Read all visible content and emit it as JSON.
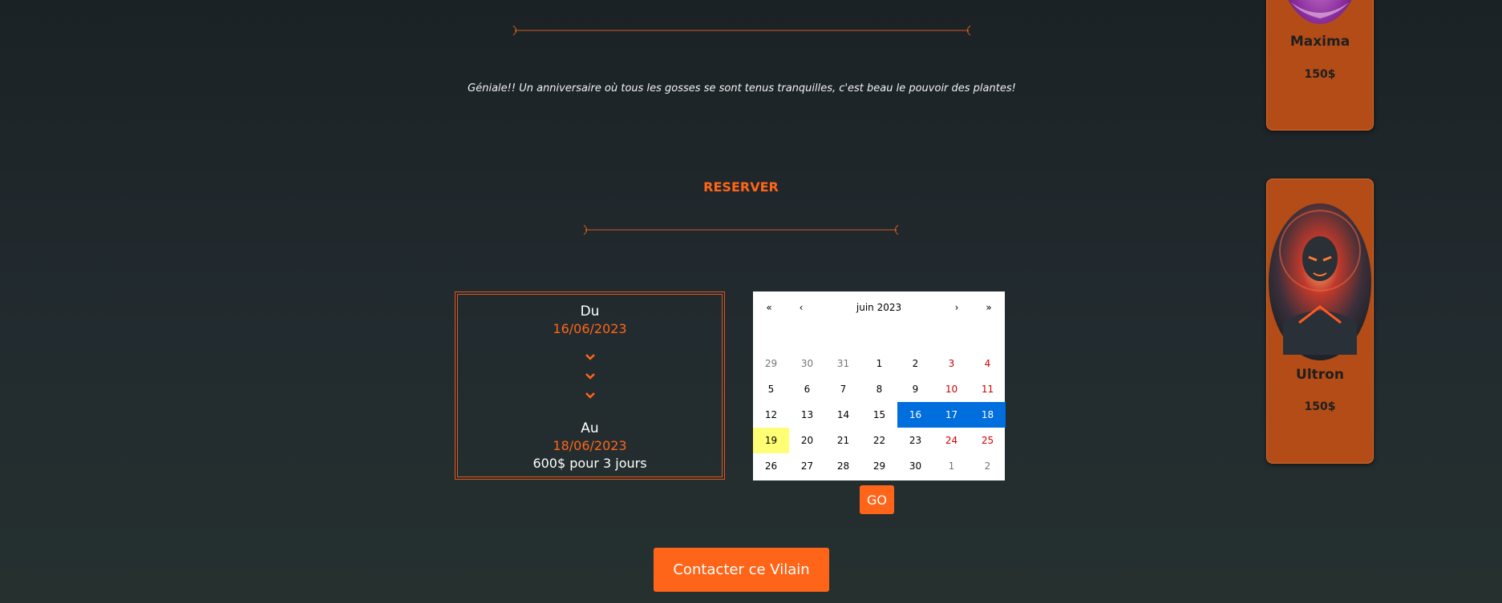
{
  "testimonial": {
    "text": "Géniale!! Un anniversaire où tous les gosses se sont tenus tranquilles, c'est beau le pouvoir des plantes!"
  },
  "reserve": {
    "title": "RESERVER",
    "from_label": "Du",
    "from_date": "16/06/2023",
    "to_label": "Au",
    "to_date": "18/06/2023",
    "total": "600$ pour 3 jours"
  },
  "calendar": {
    "month_label": "juin 2023",
    "nav_prev2": "«",
    "nav_prev": "‹",
    "nav_next": "›",
    "nav_next2": "»",
    "weeks": [
      [
        {
          "d": "29",
          "t": "muted"
        },
        {
          "d": "30",
          "t": "muted"
        },
        {
          "d": "31",
          "t": "muted"
        },
        {
          "d": "1",
          "t": ""
        },
        {
          "d": "2",
          "t": ""
        },
        {
          "d": "3",
          "t": "weekend"
        },
        {
          "d": "4",
          "t": "weekend"
        }
      ],
      [
        {
          "d": "5",
          "t": ""
        },
        {
          "d": "6",
          "t": ""
        },
        {
          "d": "7",
          "t": ""
        },
        {
          "d": "8",
          "t": ""
        },
        {
          "d": "9",
          "t": ""
        },
        {
          "d": "10",
          "t": "weekend"
        },
        {
          "d": "11",
          "t": "weekend"
        }
      ],
      [
        {
          "d": "12",
          "t": ""
        },
        {
          "d": "13",
          "t": ""
        },
        {
          "d": "14",
          "t": ""
        },
        {
          "d": "15",
          "t": ""
        },
        {
          "d": "16",
          "t": "sel"
        },
        {
          "d": "17",
          "t": "sel"
        },
        {
          "d": "18",
          "t": "sel"
        }
      ],
      [
        {
          "d": "19",
          "t": "today"
        },
        {
          "d": "20",
          "t": ""
        },
        {
          "d": "21",
          "t": ""
        },
        {
          "d": "22",
          "t": ""
        },
        {
          "d": "23",
          "t": ""
        },
        {
          "d": "24",
          "t": "weekend"
        },
        {
          "d": "25",
          "t": "weekend"
        }
      ],
      [
        {
          "d": "26",
          "t": ""
        },
        {
          "d": "27",
          "t": ""
        },
        {
          "d": "28",
          "t": ""
        },
        {
          "d": "29",
          "t": ""
        },
        {
          "d": "30",
          "t": ""
        },
        {
          "d": "1",
          "t": "muted"
        },
        {
          "d": "2",
          "t": "muted"
        }
      ]
    ]
  },
  "buttons": {
    "go": "GO",
    "contact": "Contacter ce Vilain"
  },
  "villains": [
    {
      "name": "Maxima",
      "price": "150$"
    },
    {
      "name": "Ultron",
      "price": "150$"
    }
  ],
  "colors": {
    "accent": "#ff6519",
    "card": "#b34c17",
    "selected": "#006edc",
    "today": "#ffff76",
    "weekend": "#d10000"
  }
}
